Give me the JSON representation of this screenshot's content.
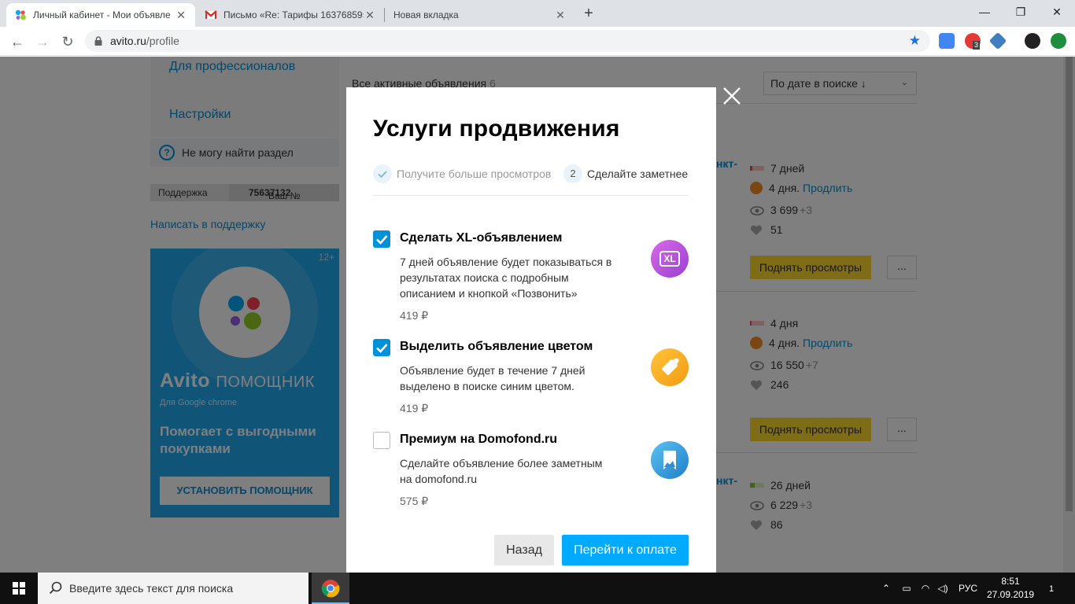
{
  "browser": {
    "tabs": [
      {
        "title": "Личный кабинет - Мои объявле",
        "active": true
      },
      {
        "title": "Письмо «Re: Тарифы 16376859»",
        "active": false
      },
      {
        "title": "Новая вкладка",
        "active": false
      }
    ],
    "url_host": "avito.ru",
    "url_path": "/profile",
    "ext_badge": "3"
  },
  "sidebar": {
    "pro_link": "Для профессионалов",
    "settings_link": "Настройки",
    "cant_find": "Не могу найти раздел",
    "support_label": "Поддержка",
    "account_prefix": "Ваш №",
    "account_number": "75637132",
    "write_support": "Написать в поддержку"
  },
  "promo": {
    "age": "12+",
    "brand_main": "Avito",
    "brand_sub": "ПОМОЩНИК",
    "for_text": "Для   Google chrome",
    "headline": "Помогает с выгодными покупками",
    "install_button": "УСТАНОВИТЬ ПОМОЩНИК"
  },
  "listings": {
    "header": "Все активные объявления",
    "count": "6",
    "sort": "По дате в поиске ↓",
    "cut_title": "нкт-",
    "items": [
      {
        "days": "7 дней",
        "promo_days": "4 дня.",
        "extend": "Продлить",
        "views": "3 699",
        "views_new": "+3",
        "favs": "51",
        "raise": "Поднять просмотры",
        "more": "..."
      },
      {
        "days": "4 дня",
        "promo_days": "4 дня.",
        "extend": "Продлить",
        "views": "16 550",
        "views_new": "+7",
        "favs": "246",
        "raise": "Поднять просмотры",
        "more": "..."
      },
      {
        "days": "26 дней",
        "views": "6 229",
        "views_new": "+3",
        "favs": "86"
      }
    ]
  },
  "modal": {
    "title": "Услуги продвижения",
    "step1": "Получите больше просмотров",
    "step2_num": "2",
    "step2": "Сделайте заметнее",
    "services": [
      {
        "name": "Сделать XL-объявлением",
        "desc": "7 дней объявление будет показываться в результатах поиска с подробным описанием и кнопкой «Позвонить»",
        "price": "419 ₽",
        "checked": true,
        "icon": "xl-badge-icon",
        "icon_text": "XL",
        "color": "#b347d6"
      },
      {
        "name": "Выделить объявление цветом",
        "desc": "Объявление будет в течение 7 дней выделено в поиске синим цветом.",
        "price": "419 ₽",
        "checked": true,
        "icon": "highlighter-icon",
        "color": "#f5a623"
      },
      {
        "name": "Премиум на Domofond.ru",
        "desc": "Сделайте объявление более заметным на domofond.ru",
        "price": "575 ₽",
        "checked": false,
        "icon": "bookmark-icon",
        "color": "#2d8fd5"
      }
    ],
    "back": "Назад",
    "pay": "Перейти к оплате"
  },
  "taskbar": {
    "search_placeholder": "Введите здесь текст для поиска",
    "lang": "РУС",
    "time": "8:51",
    "date": "27.09.2019",
    "notifications": "1"
  },
  "colors": {
    "accent": "#0091d9",
    "pay_button": "#00aaff",
    "raise_button": "#ffd92e",
    "promo_bg": "#21a9f0"
  }
}
